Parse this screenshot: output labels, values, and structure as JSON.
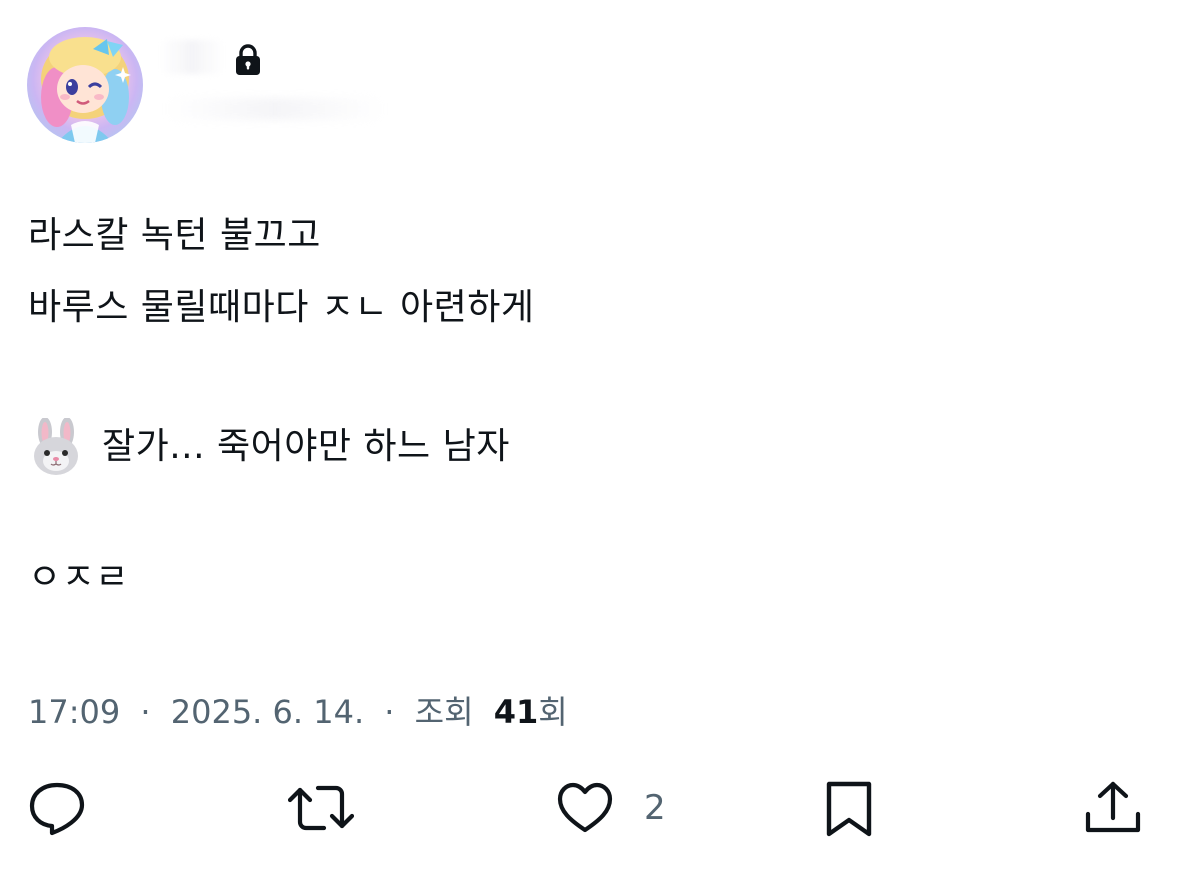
{
  "author": {
    "name": "",
    "handle": "",
    "protected_icon": "lock-icon",
    "avatar_icon": "avatar-image"
  },
  "tweet": {
    "lines": [
      "라스칼 녹턴 불끄고",
      "바루스 물릴때마다 ㅈㄴ 아련하게",
      "잘가... 죽어야만 하느 남자",
      "ㅇㅈㄹ"
    ],
    "emoji_icon": "rabbit-face-icon"
  },
  "meta": {
    "time": "17:09",
    "date": "2025. 6. 14.",
    "views_label": "조회",
    "views_count": "41",
    "views_suffix": "회",
    "separator": "·"
  },
  "actions": {
    "reply_icon": "reply-icon",
    "retweet_icon": "retweet-icon",
    "like_icon": "heart-icon",
    "like_count": "2",
    "bookmark_icon": "bookmark-icon",
    "share_icon": "share-icon"
  },
  "colors": {
    "text": "#0f1419",
    "secondary": "#536471",
    "background": "#ffffff"
  }
}
